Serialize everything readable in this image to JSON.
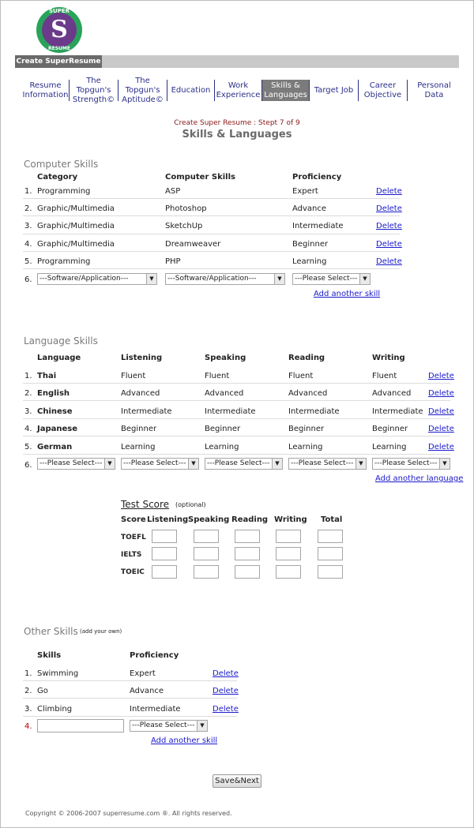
{
  "logo": {
    "top": "SUPER",
    "letter": "S",
    "bottom": "RESUME",
    "green": "#29a35a",
    "purple": "#6b3a8a"
  },
  "topbar": {
    "label": "Create SuperResume"
  },
  "nav": [
    {
      "l1": "Resume",
      "l2": "Information",
      "active": false
    },
    {
      "l1": "The Topgun's",
      "l2": "Strength©",
      "active": false
    },
    {
      "l1": "The Topgun's",
      "l2": "Aptitude©",
      "active": false
    },
    {
      "l1": "Education",
      "l2": "",
      "active": false
    },
    {
      "l1": "Work",
      "l2": "Experience",
      "active": false
    },
    {
      "l1": "Skills &",
      "l2": "Languages",
      "active": true
    },
    {
      "l1": "Target Job",
      "l2": "",
      "active": false
    },
    {
      "l1": "Career",
      "l2": "Objective",
      "active": false
    },
    {
      "l1": "Personal Data",
      "l2": "",
      "active": false
    }
  ],
  "step": "Create Super Resume : Stept 7 of 9",
  "title": "Skills & Languages",
  "computer": {
    "title": "Computer Skills",
    "headers": [
      "Category",
      "Computer Skills",
      "Proficiency"
    ],
    "rows": [
      {
        "n": "1.",
        "cat": "Programming",
        "skill": "ASP",
        "prof": "Expert",
        "del": "Delete"
      },
      {
        "n": "2.",
        "cat": "Graphic/Multimedia",
        "skill": "Photoshop",
        "prof": "Advance",
        "del": "Delete"
      },
      {
        "n": "3.",
        "cat": "Graphic/Multimedia",
        "skill": "SketchUp",
        "prof": "Intermediate",
        "del": "Delete"
      },
      {
        "n": "4.",
        "cat": "Graphic/Multimedia",
        "skill": "Dreamweaver",
        "prof": "Beginner",
        "del": "Delete"
      },
      {
        "n": "5.",
        "cat": "Programming",
        "skill": "PHP",
        "prof": "Learning",
        "del": "Delete"
      }
    ],
    "new_n": "6.",
    "sel_cat": "---Software/Application---",
    "sel_skill": "---Software/Application---",
    "sel_prof": "---Please Select---",
    "add": "Add another skill"
  },
  "language": {
    "title": "Language Skills",
    "headers": [
      "Language",
      "Listening",
      "Speaking",
      "Reading",
      "Writing"
    ],
    "rows": [
      {
        "n": "1.",
        "lang": "Thai",
        "l": "Fluent",
        "s": "Fluent",
        "r": "Fluent",
        "w": "Fluent",
        "del": "Delete"
      },
      {
        "n": "2.",
        "lang": "English",
        "l": "Advanced",
        "s": "Advanced",
        "r": "Advanced",
        "w": "Advanced",
        "del": "Delete"
      },
      {
        "n": "3.",
        "lang": "Chinese",
        "l": "Intermediate",
        "s": "Intermediate",
        "r": "Intermediate",
        "w": "Intermediate",
        "del": "Delete"
      },
      {
        "n": "4.",
        "lang": "Japanese",
        "l": "Beginner",
        "s": "Beginner",
        "r": "Beginner",
        "w": "Beginner",
        "del": "Delete"
      },
      {
        "n": "5.",
        "lang": "German",
        "l": "Learning",
        "s": "Learning",
        "r": "Learning",
        "w": "Learning",
        "del": "Delete"
      }
    ],
    "new_n": "6.",
    "sel": "---Please Select---",
    "add": "Add another language"
  },
  "test": {
    "title": "Test Score",
    "optional": "(optional)",
    "headers": [
      "Score",
      "Listening",
      "Speaking",
      "Reading",
      "Writing",
      "Total"
    ],
    "rows": [
      "TOEFL",
      "IELTS",
      "TOEIC"
    ]
  },
  "other": {
    "title": "Other Skills",
    "note": "(add your own)",
    "headers": [
      "Skills",
      "Proficiency"
    ],
    "rows": [
      {
        "n": "1.",
        "skill": "Swimming",
        "prof": "Expert",
        "del": "Delete"
      },
      {
        "n": "2.",
        "skill": "Go",
        "prof": "Advance",
        "del": "Delete"
      },
      {
        "n": "3.",
        "skill": "Climbing",
        "prof": "Intermediate",
        "del": "Delete"
      }
    ],
    "new_n": "4.",
    "sel": "---Please Select---",
    "add": "Add another skill"
  },
  "save": "Save&Next",
  "footer": "Copyright © 2006-2007 superresume.com ®. All rights reserved."
}
